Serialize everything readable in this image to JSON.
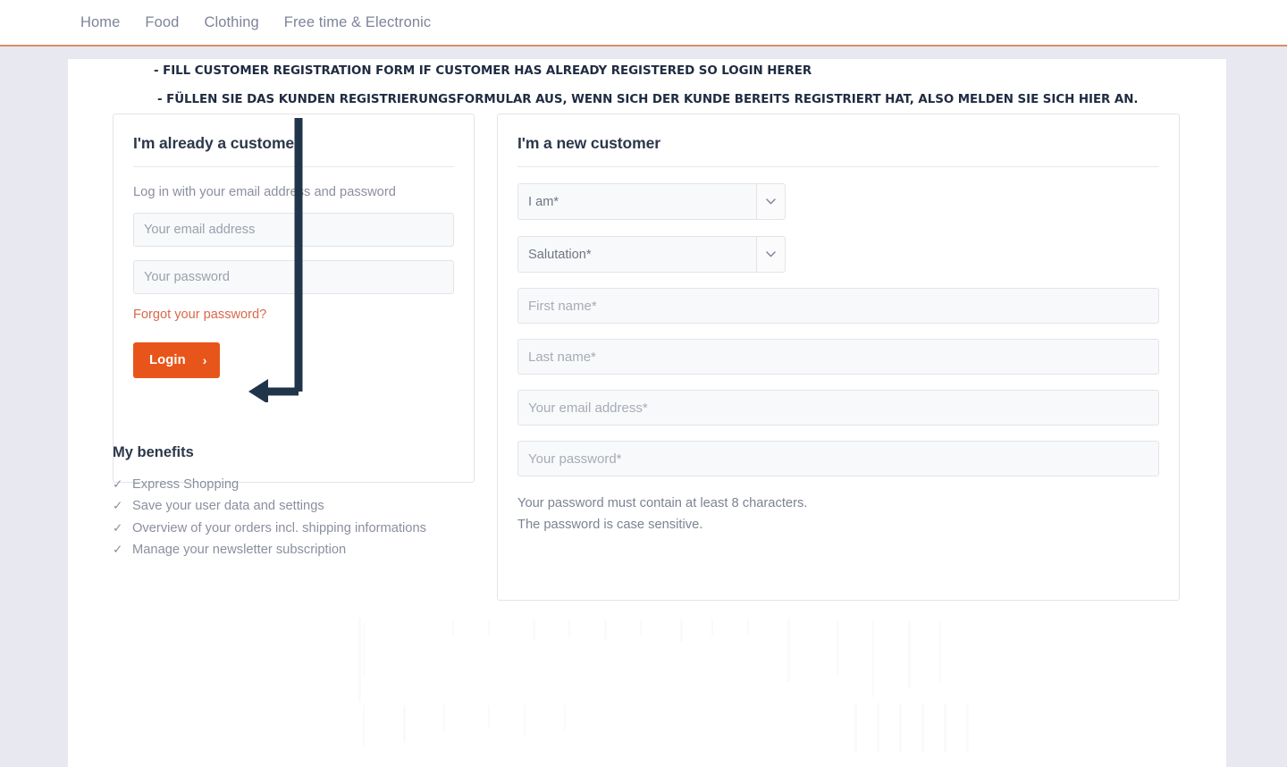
{
  "nav": {
    "items": [
      {
        "label": "Home"
      },
      {
        "label": "Food"
      },
      {
        "label": "Clothing"
      },
      {
        "label": "Free time & Electronic"
      }
    ]
  },
  "annotation": {
    "instruction_en": "- FILL CUSTOMER REGISTRATION FORM IF CUSTOMER HAS ALREADY REGISTERED SO LOGIN HERER",
    "instruction_de": "- FÜLLEN SIE DAS KUNDEN REGISTRIERUNGSFORMULAR AUS, WENN SICH DER KUNDE BEREITS REGISTRIERT HAT, ALSO MELDEN SIE SICH HIER AN.",
    "arrow_color": "#20344a",
    "arrow_target": "login-button"
  },
  "login_panel": {
    "title": "I'm already a customer.",
    "subtitle": "Log in with your email address and password",
    "email_placeholder": "Your email address",
    "email_value": "",
    "password_placeholder": "Your password",
    "password_value": "",
    "forgot_label": "Forgot your password?",
    "login_label": "Login",
    "login_chevron": "›",
    "accent_color": "#e8551b",
    "link_color": "#d9684a"
  },
  "benefits": {
    "title": "My benefits",
    "check_glyph": "✓",
    "items": [
      {
        "label": "Express Shopping"
      },
      {
        "label": "Save your user data and settings"
      },
      {
        "label": "Overview of your orders incl. shipping informations"
      },
      {
        "label": "Manage your newsletter subscription"
      }
    ]
  },
  "register_panel": {
    "title": "I'm a new customer",
    "iam_select": {
      "value": "I am*",
      "icon": "chevron-down-icon"
    },
    "salutation_select": {
      "value": "Salutation*",
      "icon": "chevron-down-icon"
    },
    "first_name_placeholder": "First name*",
    "first_name_value": "",
    "last_name_placeholder": "Last name*",
    "last_name_value": "",
    "email_placeholder": "Your email address*",
    "email_value": "",
    "password_placeholder": "Your password*",
    "password_value": "",
    "hint_line_1": "Your password must contain at least 8 characters.",
    "hint_line_2": "The password is case sensitive."
  },
  "theme": {
    "page_background": "#e8e8f0",
    "card_background": "#ffffff",
    "border_color": "#e3e4ea",
    "nav_underline": "#d98d6a",
    "heading_color": "#2c3749",
    "muted_text": "#8a8f9e"
  }
}
